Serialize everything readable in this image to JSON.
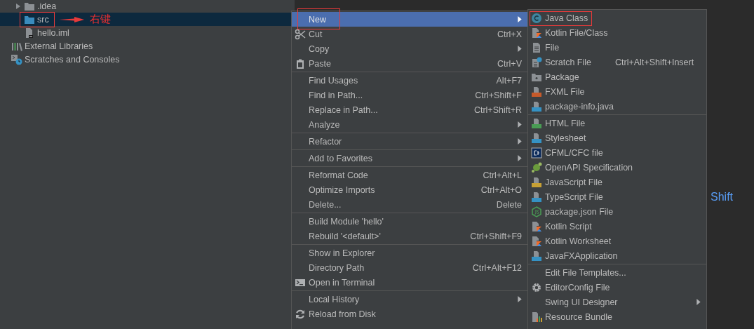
{
  "project_tree": {
    "items": [
      {
        "children": [
          {
            "label": ".idea",
            "kind": "folder",
            "expanded": false,
            "selected": false,
            "annotated": false
          },
          {
            "label": "src",
            "kind": "source-folder",
            "selected": true,
            "annotated": true
          },
          {
            "label": "hello.iml",
            "kind": "module-file",
            "selected": false,
            "annotated": false
          }
        ]
      },
      {
        "label": "External Libraries",
        "kind": "libraries",
        "selected": false,
        "annotated": false
      },
      {
        "label": "Scratches and Consoles",
        "kind": "scratches",
        "selected": false,
        "annotated": false
      }
    ]
  },
  "annotation": {
    "text": "右键"
  },
  "editor": {
    "text": "Shift"
  },
  "context_menu": {
    "groups": [
      [
        {
          "label": "New",
          "submenu": true,
          "selected": true,
          "annotated": true
        },
        {
          "label": "Cut",
          "shortcut": "Ctrl+X",
          "kind": "cut",
          "selected": false
        },
        {
          "label": "Copy",
          "submenu": true,
          "selected": false
        },
        {
          "label": "Paste",
          "shortcut": "Ctrl+V",
          "kind": "paste",
          "selected": false
        }
      ],
      [
        {
          "label": "Find Usages",
          "shortcut": "Alt+F7",
          "selected": false
        },
        {
          "label": "Find in Path...",
          "shortcut": "Ctrl+Shift+F",
          "selected": false
        },
        {
          "label": "Replace in Path...",
          "shortcut": "Ctrl+Shift+R",
          "selected": false
        },
        {
          "label": "Analyze",
          "submenu": true,
          "selected": false
        }
      ],
      [
        {
          "label": "Refactor",
          "submenu": true,
          "selected": false
        }
      ],
      [
        {
          "label": "Add to Favorites",
          "submenu": true,
          "selected": false
        }
      ],
      [
        {
          "label": "Reformat Code",
          "shortcut": "Ctrl+Alt+L",
          "selected": false
        },
        {
          "label": "Optimize Imports",
          "shortcut": "Ctrl+Alt+O",
          "selected": false
        },
        {
          "label": "Delete...",
          "shortcut": "Delete",
          "selected": false
        }
      ],
      [
        {
          "label": "Build Module 'hello'",
          "selected": false
        },
        {
          "label": "Rebuild '<default>'",
          "shortcut": "Ctrl+Shift+F9",
          "selected": false
        }
      ],
      [
        {
          "label": "Show in Explorer",
          "selected": false
        },
        {
          "label": "Directory Path",
          "shortcut": "Ctrl+Alt+F12",
          "selected": false
        },
        {
          "label": "Open in Terminal",
          "kind": "terminal",
          "selected": false
        }
      ],
      [
        {
          "label": "Local History",
          "submenu": true,
          "selected": false
        },
        {
          "label": "Reload from Disk",
          "kind": "reload",
          "selected": false
        }
      ]
    ]
  },
  "new_submenu": {
    "groups": [
      [
        {
          "label": "Java Class",
          "kind": "java-class",
          "selected": false,
          "annotated": true
        },
        {
          "label": "Kotlin File/Class",
          "kind": "kotlin",
          "selected": false
        },
        {
          "label": "File",
          "kind": "file",
          "selected": false
        },
        {
          "label": "Scratch File",
          "shortcut": "Ctrl+Alt+Shift+Insert",
          "kind": "scratch",
          "selected": false
        },
        {
          "label": "Package",
          "kind": "package",
          "selected": false
        },
        {
          "label": "FXML File",
          "kind": "fxml",
          "selected": false
        },
        {
          "label": "package-info.java",
          "kind": "java-file",
          "selected": false
        }
      ],
      [
        {
          "label": "HTML File",
          "kind": "html",
          "selected": false
        },
        {
          "label": "Stylesheet",
          "kind": "css",
          "selected": false
        },
        {
          "label": "CFML/CFC file",
          "kind": "cfml",
          "selected": false
        },
        {
          "label": "OpenAPI Specification",
          "kind": "openapi",
          "selected": false
        },
        {
          "label": "JavaScript File",
          "kind": "js",
          "selected": false
        },
        {
          "label": "TypeScript File",
          "kind": "ts",
          "selected": false
        },
        {
          "label": "package.json File",
          "kind": "nodejs",
          "selected": false
        },
        {
          "label": "Kotlin Script",
          "kind": "kotlin-script",
          "selected": false
        },
        {
          "label": "Kotlin Worksheet",
          "kind": "kotlin-script",
          "selected": false
        },
        {
          "label": "JavaFXApplication",
          "kind": "java-file",
          "selected": false
        }
      ],
      [
        {
          "label": "Edit File Templates...",
          "selected": false
        },
        {
          "label": "EditorConfig File",
          "kind": "gear",
          "selected": false
        },
        {
          "label": "Swing UI Designer",
          "submenu": true,
          "selected": false
        },
        {
          "label": "Resource Bundle",
          "kind": "resource-bundle",
          "selected": false
        }
      ]
    ]
  }
}
